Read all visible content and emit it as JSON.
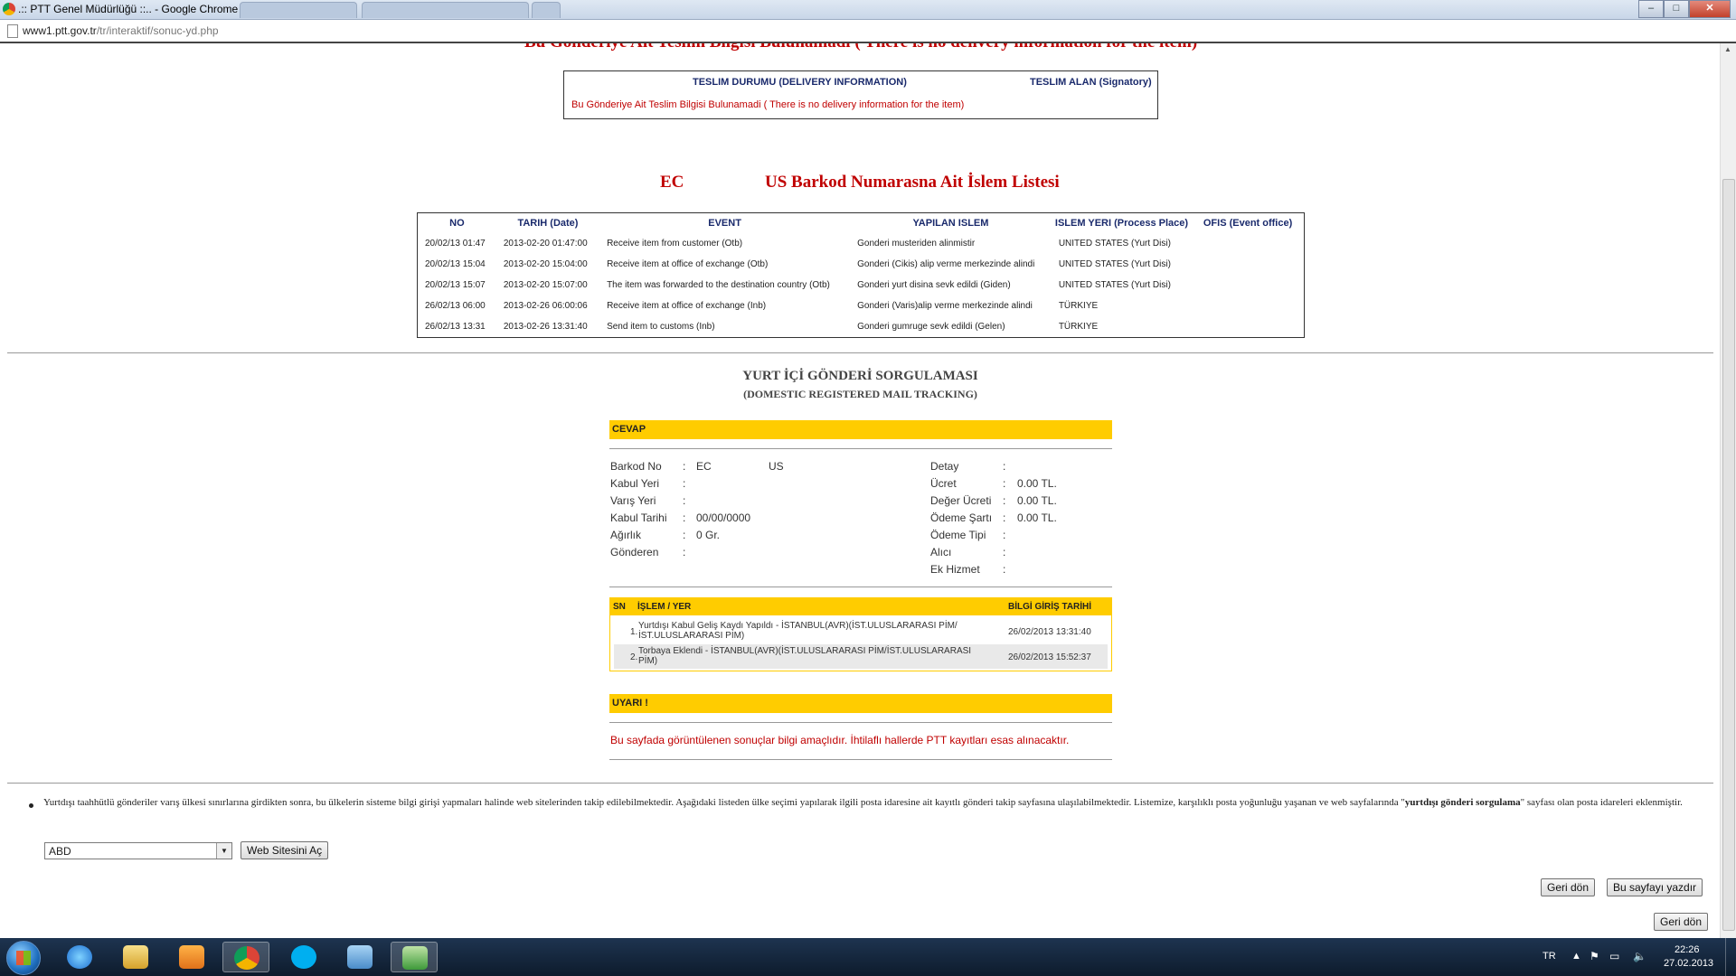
{
  "browser": {
    "window_title": ".:: PTT Genel Müdürlüğü ::.. - Google Chrome",
    "url_host": "www1.ptt.gov.tr",
    "url_path": "/tr/interaktif/sonuc-yd.php"
  },
  "top_heading_cut": "Bu Gönderiye Ait Teslim Bilgisi Bulunamadi ( There is no delivery information for the item)",
  "delivery_box": {
    "col1": "TESLIM DURUMU (DELIVERY INFORMATION)",
    "col2": "TESLIM ALAN (Signatory)",
    "message": "Bu Gönderiye Ait Teslim Bilgisi Bulunamadi ( There is no delivery information for the item)"
  },
  "list_heading": {
    "prefix": "EC",
    "suffix": "US Barkod Numarasna Ait İslem Listesi"
  },
  "events_table": {
    "headers": [
      "NO",
      "TARIH (Date)",
      "EVENT",
      "YAPILAN ISLEM",
      "ISLEM YERI (Process Place)",
      "OFIS (Event office)"
    ],
    "rows": [
      [
        "20/02/13 01:47",
        "2013-02-20 01:47:00",
        "Receive item from customer (Otb)",
        "Gonderi musteriden alinmistir",
        "UNITED STATES (Yurt Disi)",
        ""
      ],
      [
        "20/02/13 15:04",
        "2013-02-20 15:04:00",
        "Receive item at office of exchange (Otb)",
        "Gonderi (Cikis) alip verme merkezinde alindi",
        "UNITED STATES (Yurt Disi)",
        ""
      ],
      [
        "20/02/13 15:07",
        "2013-02-20 15:07:00",
        "The item was forwarded to the destination country (Otb)",
        "Gonderi yurt disina sevk edildi (Giden)",
        "UNITED STATES (Yurt Disi)",
        ""
      ],
      [
        "26/02/13 06:00",
        "2013-02-26 06:00:06",
        "Receive item at office of exchange (Inb)",
        "Gonderi (Varis)alip verme merkezinde alindi",
        "TÜRKIYE",
        ""
      ],
      [
        "26/02/13 13:31",
        "2013-02-26 13:31:40",
        "Send item to customs (Inb)",
        "Gonderi gumruge sevk edildi (Gelen)",
        "TÜRKIYE",
        ""
      ]
    ]
  },
  "domestic": {
    "title": "YURT İÇİ GÖNDERİ SORGULAMASI",
    "subtitle": "(DOMESTIC REGISTERED MAIL TRACKING)",
    "cevap_label": "CEVAP",
    "left_fields": [
      {
        "label": "Barkod No",
        "sep": ":",
        "value": "EC",
        "value2": "US"
      },
      {
        "label": "Kabul Yeri",
        "sep": ":",
        "value": "",
        "value2": ""
      },
      {
        "label": "Varış Yeri",
        "sep": ":",
        "value": "",
        "value2": ""
      },
      {
        "label": "Kabul Tarihi",
        "sep": ":",
        "value": "00/00/0000",
        "value2": ""
      },
      {
        "label": "Ağırlık",
        "sep": ":",
        "value": "0 Gr.",
        "value2": ""
      },
      {
        "label": "Gönderen",
        "sep": ":",
        "value": "",
        "value2": ""
      }
    ],
    "right_fields": [
      {
        "label": "Detay",
        "sep": ":",
        "value": ""
      },
      {
        "label": "Ücret",
        "sep": ":",
        "value": "0.00 TL."
      },
      {
        "label": "Değer Ücreti",
        "sep": ":",
        "value": "0.00 TL."
      },
      {
        "label": "Ödeme Şartı",
        "sep": ":",
        "value": "0.00 TL."
      },
      {
        "label": "Ödeme Tipi",
        "sep": ":",
        "value": ""
      },
      {
        "label": "Alıcı",
        "sep": ":",
        "value": ""
      },
      {
        "label": "Ek Hizmet",
        "sep": ":",
        "value": ""
      }
    ],
    "islem_headers": {
      "sn": "SN",
      "islem": "İŞLEM / YER",
      "tarih": "BİLGİ GİRİŞ TARİHİ"
    },
    "islem_rows": [
      {
        "sn": "1.",
        "line1": "Yurtdışı Kabul Geliş Kaydı Yapıldı - İSTANBUL(AVR)(İST.ULUSLARARASI PİM/",
        "line2": "İST.ULUSLARARASI PİM)",
        "date": "26/02/2013 13:31:40"
      },
      {
        "sn": "2.",
        "line1": "Torbaya Eklendi - İSTANBUL(AVR)(İST.ULUSLARARASI PİM/İST.ULUSLARARASI",
        "line2": "PİM)",
        "date": "26/02/2013 15:52:37"
      }
    ],
    "uyari_label": "UYARI !",
    "uyari_text": "Bu sayfada görüntülenen sonuçlar bilgi amaçlıdır. İhtilaflı hallerde PTT kayıtları esas alınacaktır."
  },
  "bottom": {
    "info_pre": "Yurtdışı taahhütlü gönderiler varış ülkesi sınırlarına girdikten sonra, bu ülkelerin sisteme bilgi girişi yapmaları halinde web sitelerinden takip edilebilmektedir. Aşağıdaki listeden ülke seçimi yapılarak ilgili posta idaresine ait kayıtlı gönderi takip sayfasına ulaşılabilmektedir. Listemize, karşılıklı posta yoğunluğu yaşanan ve web sayfalarında \"",
    "info_bold": "yurtdışı gönderi sorgulama",
    "info_post": "\" sayfası olan posta idareleri eklenmiştir.",
    "country_selected": "ABD",
    "open_site_label": "Web Sitesini Aç",
    "back_label": "Geri dön",
    "print_label": "Bu sayfayı yazdır",
    "back_label_2": "Geri dön"
  },
  "taskbar": {
    "lang": "TR",
    "time": "22:26",
    "date": "27.02.2013"
  },
  "colors": {
    "accent_red": "#c00000",
    "accent_yellow": "#ffcc00",
    "header_navy": "#1a2a6c"
  }
}
